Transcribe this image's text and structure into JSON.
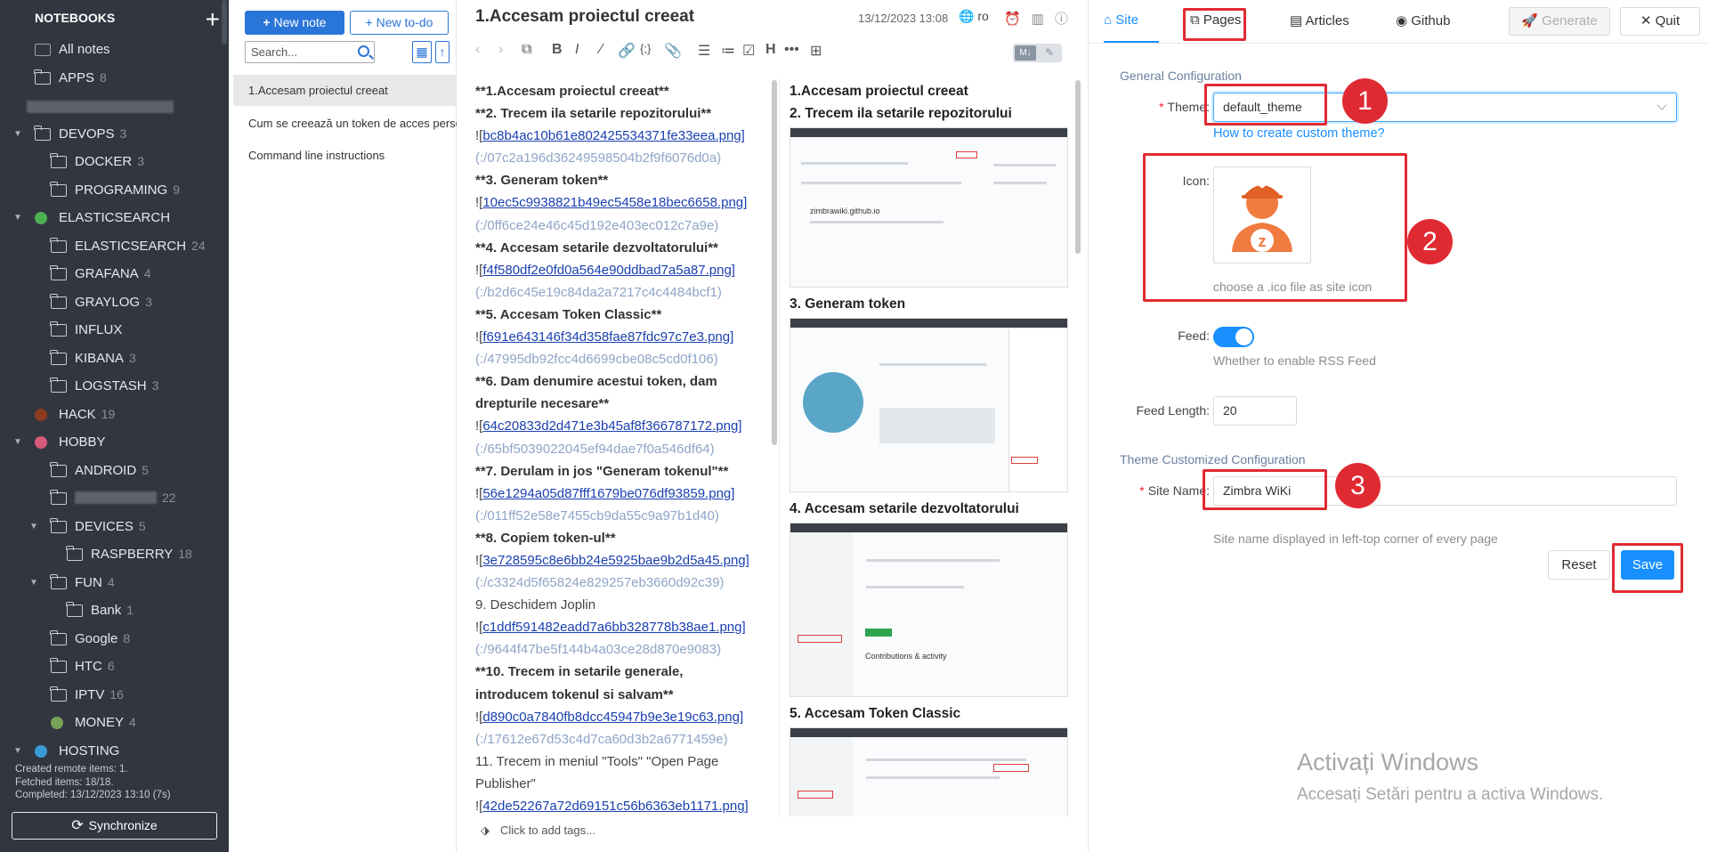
{
  "sidebar": {
    "header": "NOTEBOOKS",
    "add_icon": "plus-icon",
    "notebooks": [
      {
        "label": "All notes",
        "count": "",
        "level": 0,
        "twisty": "",
        "icon": "notes-icon"
      },
      {
        "label": "APPS",
        "count": "8",
        "level": 0,
        "twisty": "",
        "icon": "folder-icon"
      },
      {
        "label": "",
        "count": "",
        "level": 0,
        "twisty": "",
        "icon": "blurred",
        "blur": true
      },
      {
        "label": "DEVOPS",
        "count": "3",
        "level": 0,
        "twisty": "▼",
        "icon": "folder-icon"
      },
      {
        "label": "DOCKER",
        "count": "3",
        "level": 1,
        "twisty": "",
        "icon": "folder-icon"
      },
      {
        "label": "PROGRAMING",
        "count": "9",
        "level": 1,
        "twisty": "",
        "icon": "folder-icon"
      },
      {
        "label": "ELASTICSEARCH",
        "count": "",
        "level": 0,
        "twisty": "▼",
        "icon": "chart-emoji-icon"
      },
      {
        "label": "ELASTICSEARCH",
        "count": "24",
        "level": 1,
        "twisty": "",
        "icon": "folder-icon"
      },
      {
        "label": "GRAFANA",
        "count": "4",
        "level": 1,
        "twisty": "",
        "icon": "folder-icon"
      },
      {
        "label": "GRAYLOG",
        "count": "3",
        "level": 1,
        "twisty": "",
        "icon": "folder-icon"
      },
      {
        "label": "INFLUX",
        "count": "",
        "level": 1,
        "twisty": "",
        "icon": "folder-icon"
      },
      {
        "label": "KIBANA",
        "count": "3",
        "level": 1,
        "twisty": "",
        "icon": "folder-icon"
      },
      {
        "label": "LOGSTASH",
        "count": "3",
        "level": 1,
        "twisty": "",
        "icon": "folder-icon"
      },
      {
        "label": "HACK",
        "count": "19",
        "level": 0,
        "twisty": "",
        "icon": "hack-emoji-icon"
      },
      {
        "label": "HOBBY",
        "count": "",
        "level": 0,
        "twisty": "▼",
        "icon": "hobby-emoji-icon"
      },
      {
        "label": "ANDROID",
        "count": "5",
        "level": 1,
        "twisty": "",
        "icon": "folder-icon"
      },
      {
        "label": "",
        "count": "22",
        "level": 1,
        "twisty": "",
        "icon": "folder-icon",
        "blur": true
      },
      {
        "label": "DEVICES",
        "count": "5",
        "level": 1,
        "twisty": "▼",
        "icon": "folder-icon"
      },
      {
        "label": "RASPBERRY",
        "count": "18",
        "level": 2,
        "twisty": "",
        "icon": "folder-icon"
      },
      {
        "label": "FUN",
        "count": "4",
        "level": 1,
        "twisty": "▼",
        "icon": "folder-icon"
      },
      {
        "label": "Bank",
        "count": "1",
        "level": 2,
        "twisty": "",
        "icon": "folder-icon"
      },
      {
        "label": "Google",
        "count": "8",
        "level": 1,
        "twisty": "",
        "icon": "folder-icon"
      },
      {
        "label": "HTC",
        "count": "6",
        "level": 1,
        "twisty": "",
        "icon": "folder-icon"
      },
      {
        "label": "IPTV",
        "count": "16",
        "level": 1,
        "twisty": "",
        "icon": "folder-icon"
      },
      {
        "label": "MONEY",
        "count": "4",
        "level": 1,
        "twisty": "",
        "icon": "money-emoji-icon"
      },
      {
        "label": "HOSTING",
        "count": "",
        "level": 0,
        "twisty": "▼",
        "icon": "globe-emoji-icon"
      }
    ],
    "status": [
      "Created remote items: 1.",
      "Fetched items: 18/18.",
      "Completed: 13/12/2023 13:10 (7s)"
    ],
    "sync_label": "Synchronize"
  },
  "notelist": {
    "new_note": "New note",
    "new_todo": "New to-do",
    "search_placeholder": "Search...",
    "notes": [
      "1.Accesam proiectul creeat",
      "Cum se creează un token de acces personal",
      "Command line instructions"
    ]
  },
  "editor": {
    "title": "1.Accesam proiectul creeat",
    "date": "13/12/2023 13:08",
    "lang": "ro",
    "markdown": [
      {
        "t": "**1.Accesam proiectul creeat**",
        "c": "md-b"
      },
      {
        "t": "**2. Trecem ila setarile repozitorului**",
        "c": "md-b"
      },
      {
        "p": "![",
        "t": "bc8b4ac10b61e802425534371fe33eea.png]",
        "c": "md-link"
      },
      {
        "t": "(:/07c2a196d36249598504b2f9f6076d0a)",
        "c": "md-url"
      },
      {
        "t": "**3. Generam token**",
        "c": "md-b"
      },
      {
        "p": "![",
        "t": "10ec5c9938821b49ec5458e18bec6658.png]",
        "c": "md-link"
      },
      {
        "t": "(:/0ff6ce24e46c45d192e403ec012c7a9e)",
        "c": "md-url"
      },
      {
        "t": "**4. Accesam setarile dezvoltatorului**",
        "c": "md-b"
      },
      {
        "p": "![",
        "t": "f4f580df2e0fd0a564e90ddbad7a5a87.png]",
        "c": "md-link"
      },
      {
        "t": "(:/b2d6c45e19c84da2a7217c4c4484bcf1)",
        "c": "md-url"
      },
      {
        "t": "**5. Accesam Token Classic**",
        "c": "md-b"
      },
      {
        "p": "![",
        "t": "f691e643146f34d358fae87fdc97c7e3.png]",
        "c": "md-link"
      },
      {
        "t": "(:/47995db92fcc4d6699cbe08c5cd0f106)",
        "c": "md-url"
      },
      {
        "t": "**6. Dam denumire acestui token, dam",
        "c": "md-b"
      },
      {
        "t": "drepturile necesare**",
        "c": "md-b"
      },
      {
        "p": "![",
        "t": "64c20833d2d471e3b45af8f366787172.png]",
        "c": "md-link"
      },
      {
        "t": "(:/65bf5039022045ef94dae7f0a546df64)",
        "c": "md-url"
      },
      {
        "t": "**7. Derulam in jos \"Generam tokenul\"**",
        "c": "md-b"
      },
      {
        "p": "![",
        "t": "56e1294a05d87fff1679be076df93859.png]",
        "c": "md-link"
      },
      {
        "t": "(:/011ff52e58e7455cb9da55c9a97b1d40)",
        "c": "md-url"
      },
      {
        "t": "**8. Copiem token-ul**",
        "c": "md-b"
      },
      {
        "p": "![",
        "t": "3e728595c8e6bb24e5925bae9b2d5a45.png]",
        "c": "md-link"
      },
      {
        "t": "(:/c3324d5f65824e829257eb3660d92c39)",
        "c": "md-url"
      },
      {
        "t": "9. Deschidem Joplin",
        "c": "md-plain"
      },
      {
        "p": "![",
        "t": "c1ddf591482eadd7a6bb328778b38ae1.png]",
        "c": "md-link"
      },
      {
        "t": "(:/9644f47be5f144b4a03ce28d870e9083)",
        "c": "md-url"
      },
      {
        "t": "**10. Trecem in setarile generale,",
        "c": "md-b"
      },
      {
        "t": "introducem tokenul si salvam**",
        "c": "md-b"
      },
      {
        "p": "![",
        "t": "d890c0a7840fb8dcc45947b9e3e19c63.png]",
        "c": "md-link"
      },
      {
        "t": "(:/17612e67d53c4d7ca60d3b2a6771459e)",
        "c": "md-url"
      },
      {
        "t": "11. Trecem in meniul \"Tools\" \"Open Page",
        "c": "md-plain"
      },
      {
        "t": "Publisher\"",
        "c": "md-plain"
      },
      {
        "p": "![",
        "t": "42de52267a72d69151c56b6363eb1171.png]",
        "c": "md-link"
      }
    ],
    "preview_headings": [
      "1.Accesam proiectul creeat",
      "2. Trecem ila setarile repozitorului",
      "3. Generam token",
      "4. Accesam setarile dezvoltatorului",
      "5. Accesam Token Classic"
    ],
    "preview_screens": {
      "zimbra_site": "zimbrawiki.github.io",
      "contributions": "Contributions & activity"
    },
    "tags_placeholder": "Click to add tags..."
  },
  "settings": {
    "tabs": [
      "Site",
      "Pages",
      "Articles",
      "Github"
    ],
    "generate": "Generate",
    "quit": "Quit",
    "general_section": "General Configuration",
    "theme_label": "Theme:",
    "theme_value": "default_theme",
    "theme_help_link": "How to create custom theme?",
    "icon_label": "Icon:",
    "icon_help": "choose a .ico file as site icon",
    "feed_label": "Feed:",
    "feed_enabled": true,
    "feed_help": "Whether to enable RSS Feed",
    "feed_length_label": "Feed Length:",
    "feed_length_value": "20",
    "theme_custom_section": "Theme Customized Configuration",
    "site_name_label": "Site Name:",
    "site_name_value": "Zimbra WiKi",
    "site_name_help": "Site name displayed in left-top corner of every page",
    "reset": "Reset",
    "save": "Save",
    "annotations": [
      "1",
      "2",
      "3"
    ],
    "annotation_color": "#e02a32",
    "accent_color": "#1890ff"
  },
  "watermark": {
    "line1": "Activați Windows",
    "line2": "Accesați Setări pentru a activa Windows."
  }
}
